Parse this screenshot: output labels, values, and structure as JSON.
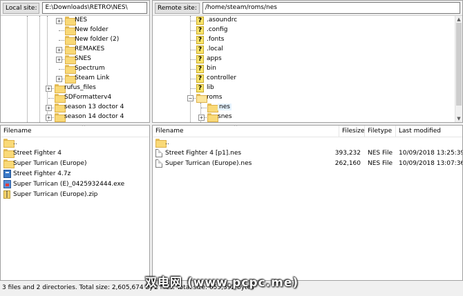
{
  "local_site": {
    "label": "Local site:",
    "path": "E:\\Downloads\\RETRO\\NES\\"
  },
  "remote_site": {
    "label": "Remote site:",
    "path": "/home/steam/roms/nes"
  },
  "local_tree": [
    {
      "label": "NES",
      "expander": "+"
    },
    {
      "label": "New folder",
      "expander": ""
    },
    {
      "label": "New folder (2)",
      "expander": ""
    },
    {
      "label": "REMAKES",
      "expander": "+"
    },
    {
      "label": "SNES",
      "expander": "+"
    },
    {
      "label": "Spectrum",
      "expander": ""
    },
    {
      "label": "Steam Link",
      "expander": "+"
    },
    {
      "label": "rufus_files",
      "expander": "+"
    },
    {
      "label": "SDFormatterv4",
      "expander": ""
    },
    {
      "label": "season 13 doctor 4",
      "expander": "+"
    },
    {
      "label": "season 14 doctor 4",
      "expander": "+"
    }
  ],
  "remote_tree": [
    {
      "label": ".asoundrc",
      "icon": "question-icon"
    },
    {
      "label": ".config",
      "icon": "question-icon"
    },
    {
      "label": ".fonts",
      "icon": "question-icon"
    },
    {
      "label": ".local",
      "icon": "question-icon"
    },
    {
      "label": "apps",
      "icon": "question-icon"
    },
    {
      "label": "bin",
      "icon": "question-icon"
    },
    {
      "label": "controller",
      "icon": "question-icon"
    },
    {
      "label": "lib",
      "icon": "question-icon"
    },
    {
      "label": "roms",
      "icon": "folder-icon",
      "expander": "−"
    },
    {
      "label": "nes",
      "icon": "folder-icon"
    },
    {
      "label": "snes",
      "icon": "folder-icon",
      "expander": "+"
    }
  ],
  "local_list": {
    "columns": {
      "filename": "Filename"
    },
    "rows": [
      {
        "name": "..",
        "icon": "folder-icon"
      },
      {
        "name": "Street Fighter 4",
        "icon": "folder-icon"
      },
      {
        "name": "Super Turrican (Europe)",
        "icon": "folder-icon"
      },
      {
        "name": "Street Fighter 4.7z",
        "icon": "archive-icon"
      },
      {
        "name": "Super Turrican (E)_0425932444.exe",
        "icon": "exe-icon"
      },
      {
        "name": "Super Turrican (Europe).zip",
        "icon": "zip-icon"
      }
    ],
    "status": "3 files and 2 directories. Total size: 2,605,674 bytes"
  },
  "remote_list": {
    "columns": {
      "filename": "Filename",
      "filesize": "Filesize",
      "filetype": "Filetype",
      "modified": "Last modified"
    },
    "rows": [
      {
        "name": "..",
        "icon": "folder-icon",
        "size": "",
        "type": "",
        "modified": ""
      },
      {
        "name": "Street Fighter 4 [p1].nes",
        "icon": "file-icon",
        "size": "393,232",
        "type": "NES File",
        "modified": "10/09/2018 13:25:39"
      },
      {
        "name": "Super Turrican (Europe).nes",
        "icon": "file-icon",
        "size": "262,160",
        "type": "NES File",
        "modified": "10/09/2018 13:07:36"
      }
    ],
    "status": "2 files. Total size: 655,392 bytes"
  },
  "watermark": "双电网 (www.pcpc.me)"
}
